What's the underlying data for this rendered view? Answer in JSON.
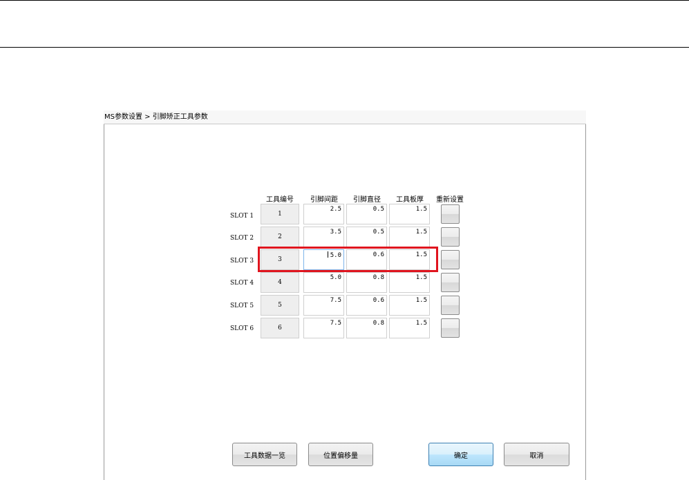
{
  "window": {
    "title": "MS参数设置 > 引脚矫正工具参数"
  },
  "table": {
    "headers": {
      "tool_no": "工具编号",
      "pin_pitch": "引脚间距",
      "pin_diameter": "引脚直径",
      "board_thickness": "工具板厚",
      "reset": "重新设置"
    },
    "rows": [
      {
        "slot": "SLOT 1",
        "tool_no": "1",
        "pitch": "2.5",
        "diameter": "0.5",
        "thickness": "1.5"
      },
      {
        "slot": "SLOT 2",
        "tool_no": "2",
        "pitch": "3.5",
        "diameter": "0.5",
        "thickness": "1.5"
      },
      {
        "slot": "SLOT 3",
        "tool_no": "3",
        "pitch": "5.0",
        "diameter": "0.6",
        "thickness": "1.5"
      },
      {
        "slot": "SLOT 4",
        "tool_no": "4",
        "pitch": "5.0",
        "diameter": "0.8",
        "thickness": "1.5"
      },
      {
        "slot": "SLOT 5",
        "tool_no": "5",
        "pitch": "7.5",
        "diameter": "0.6",
        "thickness": "1.5"
      },
      {
        "slot": "SLOT 6",
        "tool_no": "6",
        "pitch": "7.5",
        "diameter": "0.8",
        "thickness": "1.5"
      }
    ],
    "selected_row": 3
  },
  "buttons": {
    "tool_list": "工具数据一览",
    "position_offset": "位置偏移量",
    "ok": "确定",
    "cancel": "取消"
  },
  "colors": {
    "highlight": "#e0141e",
    "default_button_border": "#3c7fb1"
  }
}
